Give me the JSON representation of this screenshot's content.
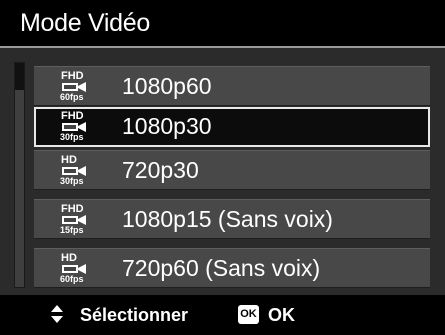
{
  "header": {
    "title": "Mode Vidéo"
  },
  "menu": {
    "items": [
      {
        "icon_quality": "FHD",
        "icon_fps": "60fps",
        "icon_name": "fhd-60fps-video-icon",
        "label": "1080p60",
        "selected": false
      },
      {
        "icon_quality": "FHD",
        "icon_fps": "30fps",
        "icon_name": "fhd-30fps-video-icon",
        "label": "1080p30",
        "selected": true
      },
      {
        "icon_quality": "HD",
        "icon_fps": "30fps",
        "icon_name": "hd-30fps-video-icon",
        "label": "720p30",
        "selected": false
      },
      {
        "icon_quality": "FHD",
        "icon_fps": "15fps",
        "icon_name": "fhd-15fps-video-icon",
        "label": "1080p15 (Sans voix)",
        "selected": false
      },
      {
        "icon_quality": "HD",
        "icon_fps": "60fps",
        "icon_name": "hd-60fps-video-icon",
        "label": "720p60 (Sans voix)",
        "selected": false
      }
    ]
  },
  "footer": {
    "navigate_icon": "up-down-arrows-icon",
    "select_label": "Sélectionner",
    "ok_icon_text": "OK",
    "ok_label": "OK"
  },
  "colors": {
    "background": "#000000",
    "list_background": "#2b2b2b",
    "row_background": "#484848",
    "selected_row_background": "#0c0c0c",
    "selected_border": "#e8e8e8",
    "text": "#ffffff"
  }
}
